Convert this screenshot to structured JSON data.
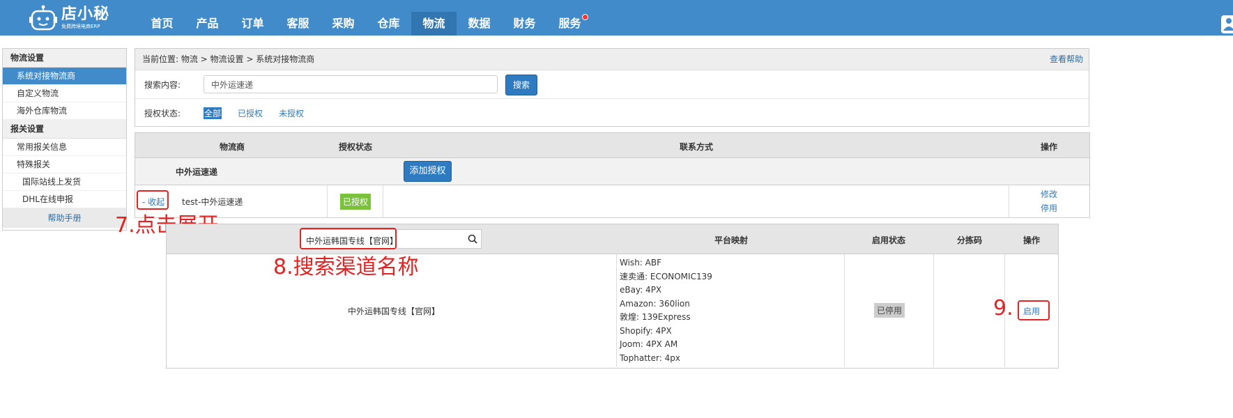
{
  "header": {
    "logo_name": "店小秘",
    "logo_sub": "免费跨境电商ERP",
    "nav": [
      "首页",
      "产品",
      "订单",
      "客服",
      "采购",
      "仓库",
      "物流",
      "数据",
      "财务",
      "服务"
    ],
    "active_nav": "物流"
  },
  "sidebar": {
    "section1": "物流设置",
    "items1": [
      "系统对接物流商",
      "自定义物流",
      "海外仓库物流"
    ],
    "section2": "报关设置",
    "items2": [
      "常用报关信息",
      "特殊报关"
    ],
    "subitems2": [
      "国际站线上发货",
      "DHL在线申报"
    ],
    "help": "帮助手册"
  },
  "breadcrumb": {
    "text": "当前位置:  物流 >  物流设置 > 系统对接物流商",
    "help": "查看帮助"
  },
  "search": {
    "label": "搜索内容:",
    "value": "中外运速递",
    "button": "搜索"
  },
  "auth_filter": {
    "label": "授权状态:",
    "options": [
      "全部",
      "已授权",
      "未授权"
    ],
    "active": "全部"
  },
  "carrier_table": {
    "headers": [
      "物流商",
      "授权状态",
      "联系方式",
      "操作"
    ],
    "group": {
      "name": "中外运速递",
      "add_button": "添加授权"
    },
    "row": {
      "collapse": "- 收起",
      "name": "test-中外运速递",
      "status": "已授权",
      "actions": [
        "修改",
        "停用"
      ]
    },
    "colors": {
      "authorized": "#7ac23c",
      "link": "#2e7bc2"
    }
  },
  "channel_table": {
    "search_value": "中外运韩国专线【官网】",
    "headers": [
      "平台映射",
      "启用状态",
      "分拣码",
      "操作"
    ],
    "row": {
      "name": "中外运韩国专线【官网】",
      "mappings": [
        "Wish:  ABF",
        "速卖通:  ECONOMIC139",
        "eBay:  4PX",
        "Amazon:  360lion",
        "敦煌:  139Express",
        "Shopify:  4PX",
        "Joom:  4PX AM",
        "Tophatter:  4px"
      ],
      "status": "已停用",
      "action": "启用"
    }
  },
  "annotations": {
    "step7": "7.点击展开",
    "step8": "8.搜索渠道名称",
    "step9": "9.",
    "color": "#e32222"
  }
}
